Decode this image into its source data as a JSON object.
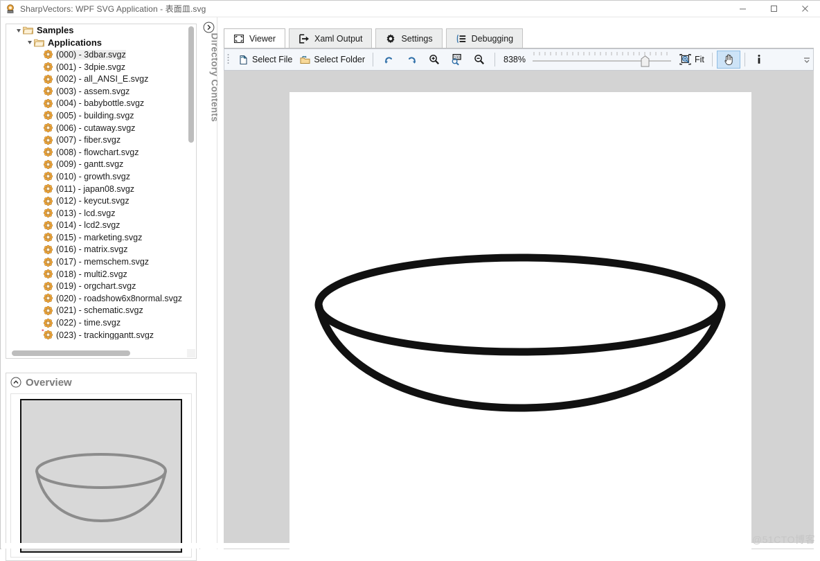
{
  "window": {
    "title": "SharpVectors: WPF SVG Application - 表面皿.svg",
    "app_icon": "sharpvectors-logo-icon",
    "minimize_label": "Minimize",
    "maximize_label": "Maximize",
    "close_label": "Close"
  },
  "directory_dock": {
    "label": "Directory Contents",
    "expander_icon": "chevron-right-circle-icon"
  },
  "tree": {
    "nodes": [
      {
        "label": "Samples",
        "level": 0,
        "type": "folder",
        "expanded": true,
        "icon": "folder-open-icon"
      },
      {
        "label": "Applications",
        "level": 1,
        "type": "folder",
        "expanded": true,
        "icon": "folder-open-icon"
      },
      {
        "label": "(000) - 3dbar.svgz",
        "level": 2,
        "type": "file",
        "icon": "svg-file-icon",
        "selected": true
      },
      {
        "label": "(001) - 3dpie.svgz",
        "level": 2,
        "type": "file",
        "icon": "svg-file-icon",
        "selected": false
      },
      {
        "label": "(002) - all_ANSI_E.svgz",
        "level": 2,
        "type": "file",
        "icon": "svg-file-icon",
        "selected": false
      },
      {
        "label": "(003) - assem.svgz",
        "level": 2,
        "type": "file",
        "icon": "svg-file-icon",
        "selected": false
      },
      {
        "label": "(004) - babybottle.svgz",
        "level": 2,
        "type": "file",
        "icon": "svg-file-icon",
        "selected": false
      },
      {
        "label": "(005) - building.svgz",
        "level": 2,
        "type": "file",
        "icon": "svg-file-icon",
        "selected": false
      },
      {
        "label": "(006) - cutaway.svgz",
        "level": 2,
        "type": "file",
        "icon": "svg-file-icon",
        "selected": false
      },
      {
        "label": "(007) - fiber.svgz",
        "level": 2,
        "type": "file",
        "icon": "svg-file-icon",
        "selected": false
      },
      {
        "label": "(008) - flowchart.svgz",
        "level": 2,
        "type": "file",
        "icon": "svg-file-icon",
        "selected": false
      },
      {
        "label": "(009) - gantt.svgz",
        "level": 2,
        "type": "file",
        "icon": "svg-file-icon",
        "selected": false
      },
      {
        "label": "(010) - growth.svgz",
        "level": 2,
        "type": "file",
        "icon": "svg-file-icon",
        "selected": false
      },
      {
        "label": "(011) - japan08.svgz",
        "level": 2,
        "type": "file",
        "icon": "svg-file-icon",
        "selected": false
      },
      {
        "label": "(012) - keycut.svgz",
        "level": 2,
        "type": "file",
        "icon": "svg-file-icon",
        "selected": false
      },
      {
        "label": "(013) - lcd.svgz",
        "level": 2,
        "type": "file",
        "icon": "svg-file-icon",
        "selected": false
      },
      {
        "label": "(014) - lcd2.svgz",
        "level": 2,
        "type": "file",
        "icon": "svg-file-icon",
        "selected": false
      },
      {
        "label": "(015) - marketing.svgz",
        "level": 2,
        "type": "file",
        "icon": "svg-file-icon",
        "selected": false
      },
      {
        "label": "(016) - matrix.svgz",
        "level": 2,
        "type": "file",
        "icon": "svg-file-icon",
        "selected": false
      },
      {
        "label": "(017) - memschem.svgz",
        "level": 2,
        "type": "file",
        "icon": "svg-file-icon",
        "selected": false
      },
      {
        "label": "(018) - multi2.svgz",
        "level": 2,
        "type": "file",
        "icon": "svg-file-icon",
        "selected": false
      },
      {
        "label": "(019) - orgchart.svgz",
        "level": 2,
        "type": "file",
        "icon": "svg-file-icon",
        "selected": false
      },
      {
        "label": "(020) - roadshow6x8normal.svgz",
        "level": 2,
        "type": "file",
        "icon": "svg-file-icon",
        "selected": false
      },
      {
        "label": "(021) - schematic.svgz",
        "level": 2,
        "type": "file",
        "icon": "svg-file-icon",
        "selected": false
      },
      {
        "label": "(022) - time.svgz",
        "level": 2,
        "type": "file",
        "icon": "svg-file-icon",
        "selected": false
      },
      {
        "label": "(023) - trackinggantt.svgz",
        "level": 2,
        "type": "file",
        "icon": "svg-file-icon",
        "selected": false
      }
    ]
  },
  "overview": {
    "title": "Overview",
    "collapse_icon": "chevron-up-circle-icon",
    "thumbnail_icon": "watch-glass-dish-thumbnail"
  },
  "tabs": [
    {
      "label": "Viewer",
      "icon": "viewer-frame-icon",
      "active": true
    },
    {
      "label": "Xaml Output",
      "icon": "arrow-export-icon",
      "active": false
    },
    {
      "label": "Settings",
      "icon": "gear-icon",
      "active": false
    },
    {
      "label": "Debugging",
      "icon": "debug-list-icon",
      "active": false
    }
  ],
  "toolbar": {
    "select_file_label": "Select File",
    "select_file_icon": "file-open-icon",
    "select_folder_label": "Select Folder",
    "select_folder_icon": "folder-open-icon",
    "undo_icon": "undo-arrow-icon",
    "redo_icon": "redo-arrow-icon",
    "zoom_in_icon": "zoom-in-magnifier-icon",
    "zoom_reset_icon": "zoom-100-magnifier-icon",
    "zoom_out_icon": "zoom-out-magnifier-icon",
    "zoom_value": "838%",
    "zoom_slider_position_percent": 78,
    "fit_label": "Fit",
    "fit_icon": "zoom-fit-icon",
    "pan_icon": "hand-pan-icon",
    "pan_active": true,
    "info_icon": "info-i-icon",
    "overflow_icon": "toolbar-overflow-icon"
  },
  "viewer": {
    "document_name": "表面皿.svg",
    "drawing_icon": "watch-glass-dish-drawing",
    "stroke_color": "#111111",
    "canvas_background": "#d3d3d3",
    "page_background": "#ffffff"
  },
  "watermark": {
    "text": "@51CTO博客"
  }
}
